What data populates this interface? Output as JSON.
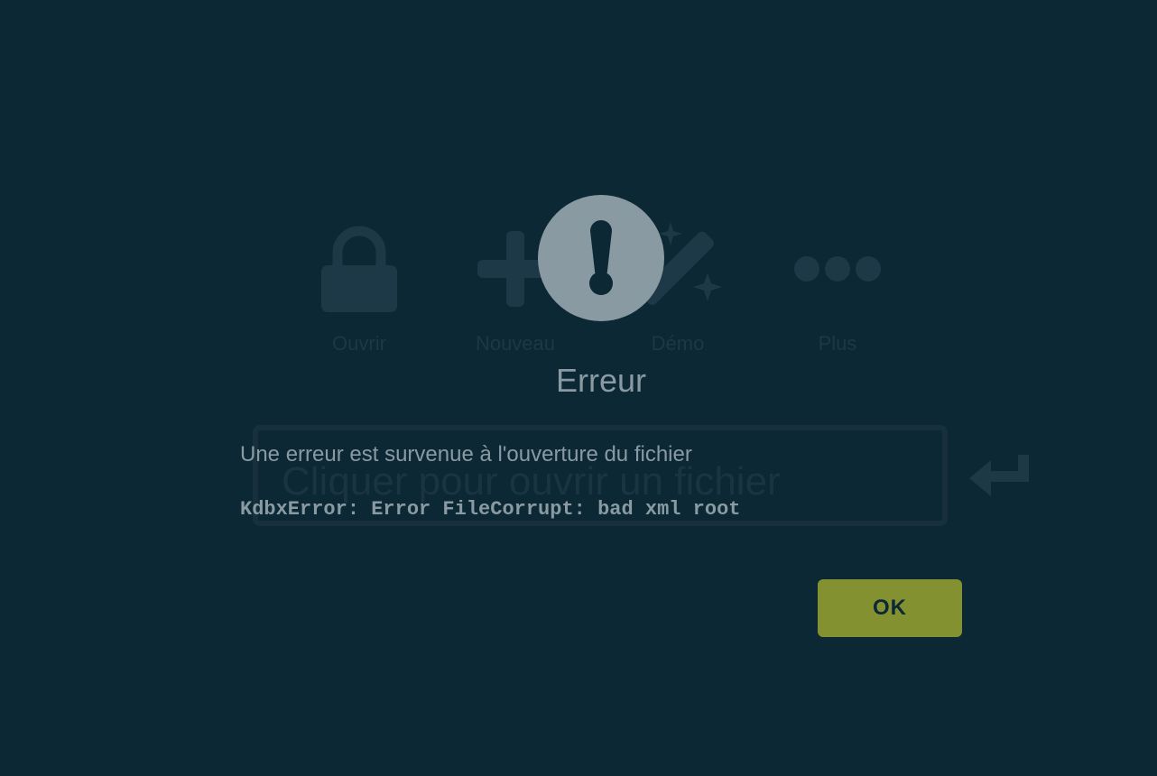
{
  "background": {
    "actions": [
      {
        "id": "open",
        "label": "Ouvrir",
        "icon": "lock-icon"
      },
      {
        "id": "new",
        "label": "Nouveau",
        "icon": "plus-icon"
      },
      {
        "id": "demo",
        "label": "Démo",
        "icon": "magic-wand-icon"
      },
      {
        "id": "more",
        "label": "Plus",
        "icon": "more-dots-icon"
      }
    ],
    "open_file_placeholder": "Cliquer pour ouvrir un fichier",
    "enter_icon": "enter-arrow-icon"
  },
  "modal": {
    "icon": "exclamation-circle-icon",
    "title": "Erreur",
    "message": "Une erreur est survenue à l'ouverture du fichier",
    "detail": "KdbxError: Error FileCorrupt: bad xml root",
    "ok_label": "OK"
  },
  "colors": {
    "background": "#0b2834",
    "dimmed_content": "#1d3846",
    "modal_text": "#8a9aa2",
    "modal_icon": "#8a9aa2",
    "ok_button": "#849130"
  }
}
